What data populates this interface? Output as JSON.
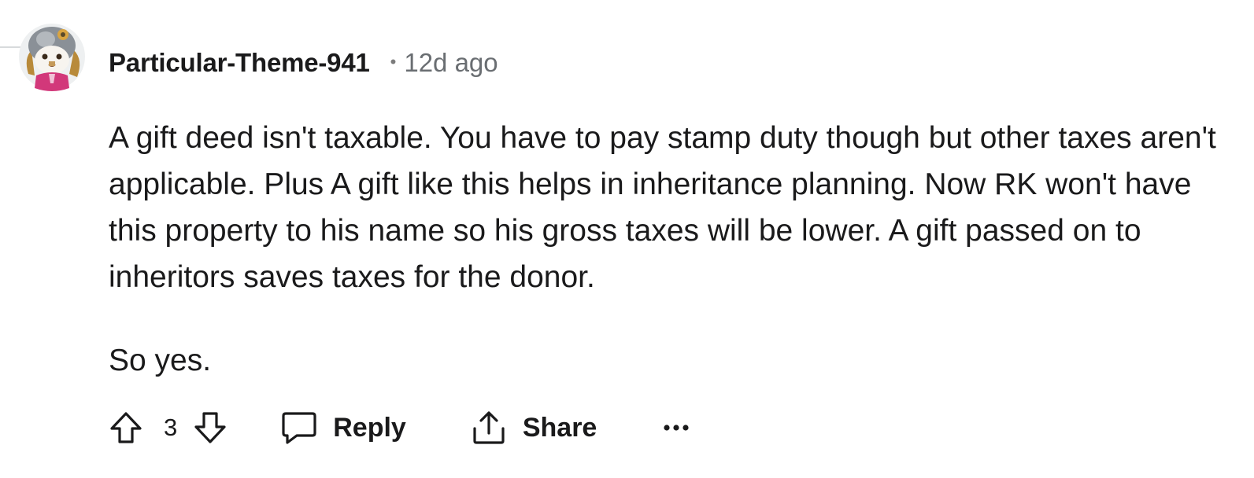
{
  "comment": {
    "username": "Particular-Theme-941",
    "separator": "•",
    "timestamp": "12d ago",
    "avatar_icon": "cartoon-avatar-icon",
    "paragraphs": [
      "A gift deed isn't taxable. You have to pay stamp duty though but other taxes aren't applicable. Plus A gift like this helps in inheritance planning. Now RK won't have this property to his name so his gross taxes will be lower. A gift passed on to inheritors saves taxes for the donor.",
      "So yes."
    ]
  },
  "actions": {
    "upvote_icon": "upvote-arrow-icon",
    "score": "3",
    "downvote_icon": "downvote-arrow-icon",
    "reply_icon": "speech-bubble-icon",
    "reply_label": "Reply",
    "share_icon": "share-upload-icon",
    "share_label": "Share",
    "more_icon": "ellipsis-icon"
  },
  "colors": {
    "text": "#1a1a1b",
    "meta": "#6a6e72",
    "thread_line": "#d7dadc"
  }
}
